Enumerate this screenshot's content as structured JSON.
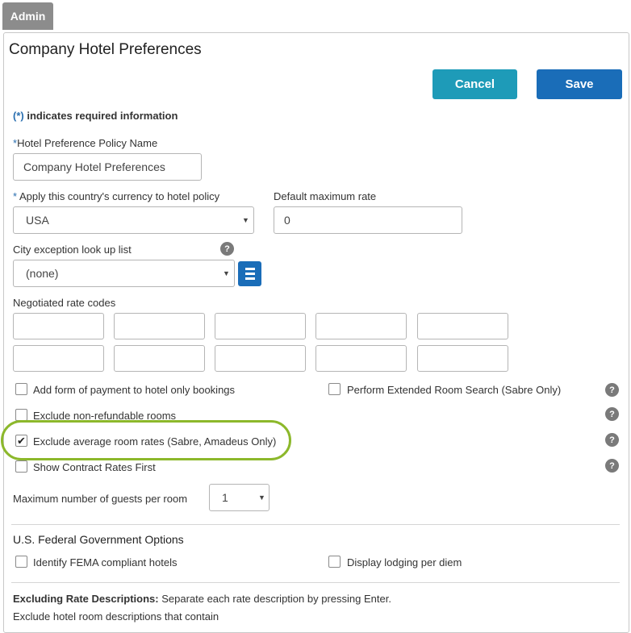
{
  "tab": {
    "label": "Admin"
  },
  "page": {
    "title": "Company Hotel Preferences"
  },
  "toolbar": {
    "cancel_label": "Cancel",
    "save_label": "Save"
  },
  "required_note": {
    "marker": "(*)",
    "text": " indicates required information"
  },
  "policy_name": {
    "asterisk": "*",
    "label": "Hotel Preference Policy Name",
    "value": "Company Hotel Preferences"
  },
  "currency": {
    "asterisk": "*",
    "label": " Apply this country's currency to hotel policy",
    "selected": "USA"
  },
  "max_rate": {
    "label": "Default maximum rate",
    "value": "0"
  },
  "city_exception": {
    "label": "City exception look up list",
    "selected": "(none)"
  },
  "negotiated": {
    "label": "Negotiated rate codes"
  },
  "options": {
    "add_payment": {
      "label": "Add form of payment to hotel only bookings",
      "checked": false
    },
    "extended_search": {
      "label": "Perform Extended Room Search (Sabre Only)",
      "checked": false
    },
    "exclude_nonrefundable": {
      "label": "Exclude non-refundable rooms",
      "checked": false
    },
    "exclude_average": {
      "label": "Exclude average room rates (Sabre, Amadeus Only)",
      "checked": true,
      "check_glyph": "✔"
    },
    "contract_first": {
      "label": "Show Contract Rates First",
      "checked": false
    }
  },
  "guests": {
    "label": "Maximum number of guests per room",
    "selected": "1"
  },
  "federal": {
    "title": "U.S. Federal Government Options",
    "fema": {
      "label": "Identify FEMA compliant hotels",
      "checked": false
    },
    "per_diem": {
      "label": "Display lodging per diem",
      "checked": false
    }
  },
  "excluding": {
    "title": "Excluding Rate Descriptions:",
    "instruction": " Separate each rate description by pressing Enter.",
    "sub_label": "Exclude hotel room descriptions that contain"
  },
  "help_glyph": "?",
  "caret_glyph": "▼",
  "colors": {
    "highlight": "#8cb82b",
    "cancel": "#1e9bb8",
    "save": "#1a6db8"
  }
}
